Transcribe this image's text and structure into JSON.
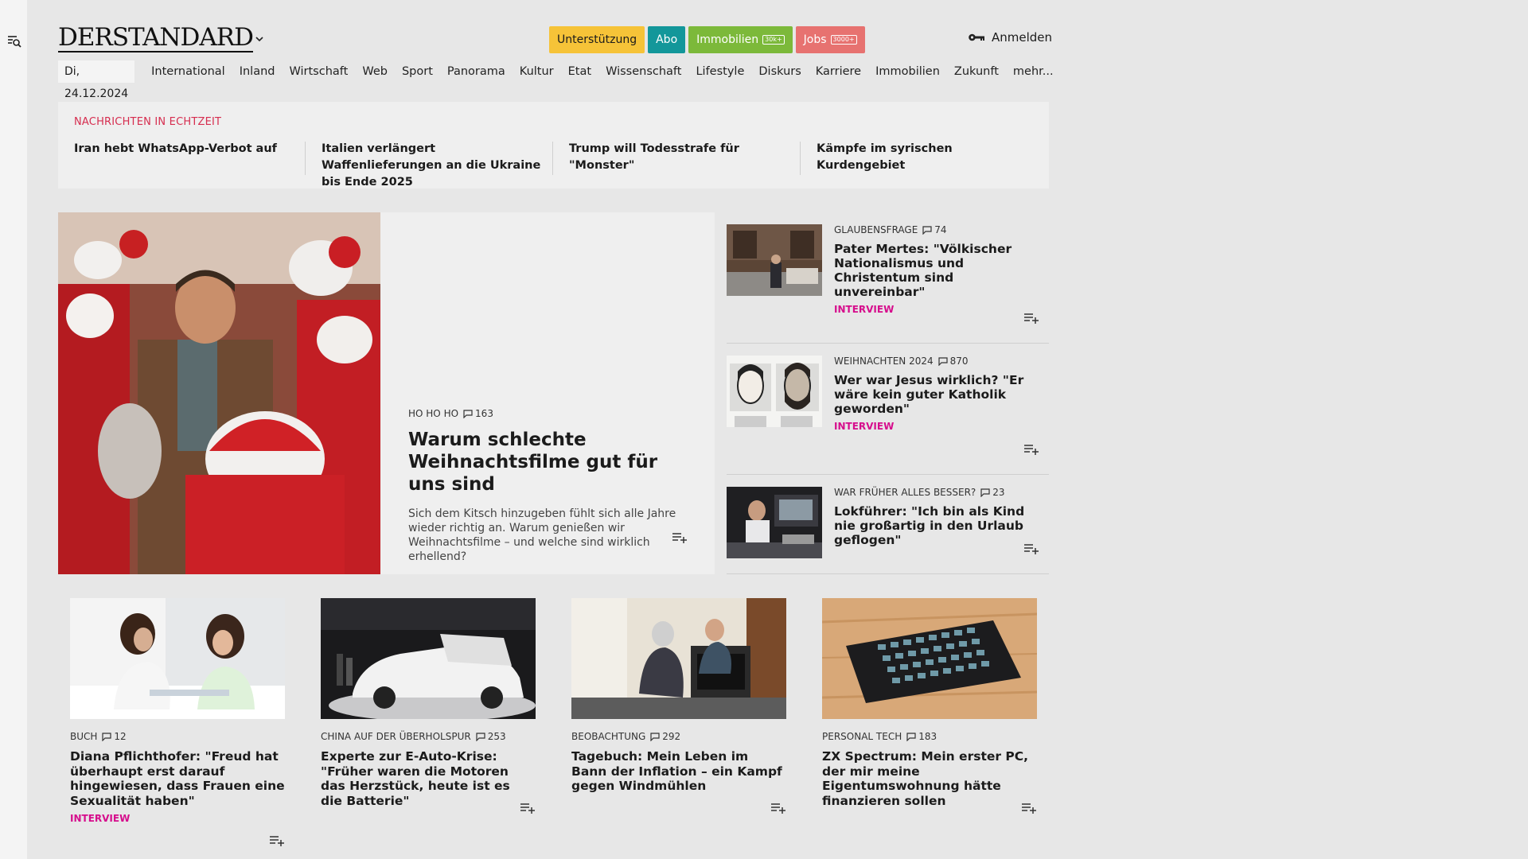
{
  "header": {
    "logo": "DERSTANDARD",
    "buttons": {
      "support": "Unterstützung",
      "abo": "Abo",
      "immobilien": "Immobilien",
      "immobilien_badge": "30k+",
      "jobs": "Jobs",
      "jobs_badge": "3000+"
    },
    "login": "Anmelden"
  },
  "nav": {
    "date": "Di, 24.12.2024",
    "items": [
      "International",
      "Inland",
      "Wirtschaft",
      "Web",
      "Sport",
      "Panorama",
      "Kultur",
      "Etat",
      "Wissenschaft",
      "Lifestyle",
      "Diskurs",
      "Karriere",
      "Immobilien",
      "Zukunft",
      "mehr..."
    ]
  },
  "ticker": {
    "label": "NACHRICHTEN IN ECHTZEIT",
    "items": [
      "Iran hebt WhatsApp-Verbot auf",
      "Italien verlängert Waffenlieferungen an die Ukraine bis Ende 2025",
      "Trump will Todesstrafe für \"Monster\"",
      "Kämpfe im syrischen Kurdengebiet"
    ]
  },
  "lead": {
    "kicker": "HO HO HO",
    "comments": "163",
    "title": "Warum schlechte Weihnachts­filme gut für uns sind",
    "description": "Sich dem Kitsch hinzugeben fühlt sich alle Jahre wieder richtig an. Warum genießen wir Weihnachts­filme – und welche sind wirklich erhellend?"
  },
  "side": [
    {
      "kicker": "GLAUBENSFRAGE",
      "comments": "74",
      "title": "Pater Mertes: \"Völkischer Nationalismus und Christentum sind unvereinbar\"",
      "tag": "INTERVIEW"
    },
    {
      "kicker": "WEIHNACHTEN 2024",
      "comments": "870",
      "title": "Wer war Jesus wirklich? \"Er wäre kein guter Katholik geworden\"",
      "tag": "INTERVIEW"
    },
    {
      "kicker": "WAR FRÜHER ALLES BESSER?",
      "comments": "23",
      "title": "Lokführer: \"Ich bin als Kind nie großartig in den Urlaub geflogen\"",
      "tag": ""
    }
  ],
  "cards": [
    {
      "kicker": "BUCH",
      "comments": "12",
      "title": "Diana Pflichthofer: \"Freud hat überhaupt erst darauf hingewiesen, dass Frauen eine Sexualität haben\"",
      "tag": "INTERVIEW"
    },
    {
      "kicker": "CHINA AUF DER ÜBERHOLSPUR",
      "comments": "253",
      "title": "Experte zur E-Auto-Krise: \"Früher waren die Motoren das Herzstück, heute ist es die Batterie\"",
      "tag": ""
    },
    {
      "kicker": "BEOBACHTUNG",
      "comments": "292",
      "title": "Tagebuch: Mein Leben im Bann der Inflation – ein Kampf gegen Windmühlen",
      "tag": ""
    },
    {
      "kicker": "PERSONAL TECH",
      "comments": "183",
      "title": "ZX Spectrum: Mein erster PC, der mir meine Eigentumswohnung hätte finanzieren sollen",
      "tag": ""
    }
  ],
  "colors": {
    "ticker_label": "#d62d4f",
    "interview_tag": "#d60d8c",
    "support": "#f6c338",
    "abo": "#13979a",
    "immobilien": "#7cb93a",
    "jobs": "#e77270"
  }
}
